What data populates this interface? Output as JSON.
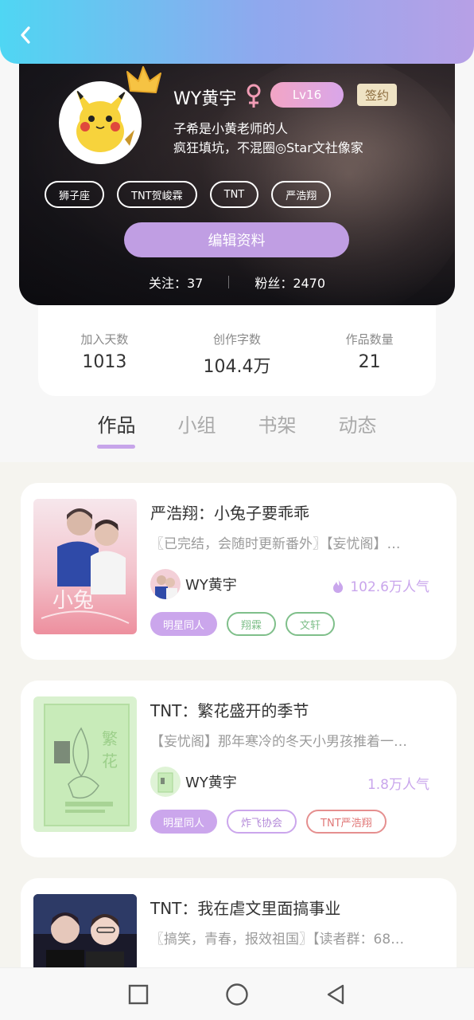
{
  "profile": {
    "username": "WY黄宇",
    "level": "Lv16",
    "sign_label": "签约",
    "bio_line1": "子希是小黄老师的人",
    "bio_line2": "疯狂填坑，不混圈◎Star文社像家",
    "tags": [
      "狮子座",
      "TNT贺峻霖",
      "TNT",
      "严浩翔"
    ],
    "edit_label": "编辑资料",
    "following_label": "关注：37",
    "followers_label": "粉丝：2470"
  },
  "stats": [
    {
      "label": "加入天数",
      "value": "1013"
    },
    {
      "label": "创作字数",
      "value": "104.4万"
    },
    {
      "label": "作品数量",
      "value": "21"
    }
  ],
  "tabs": [
    "作品",
    "小组",
    "书架",
    "动态"
  ],
  "works": [
    {
      "title": "严浩翔：小兔子要乖乖",
      "desc": "〖已完结，会随时更新番外〗【妄忧阁】…",
      "author": "WY黄宇",
      "popularity": "102.6万人气",
      "tags": [
        {
          "label": "明星同人",
          "style": "filled"
        },
        {
          "label": "翔霖",
          "style": "green"
        },
        {
          "label": "文轩",
          "style": "green"
        }
      ]
    },
    {
      "title": "TNT：繁花盛开的季节",
      "desc": "【妄忧阁】那年寒冷的冬天小男孩推着一…",
      "author": "WY黄宇",
      "popularity": "1.8万人气",
      "tags": [
        {
          "label": "明星同人",
          "style": "filled"
        },
        {
          "label": "炸飞协会",
          "style": "purple"
        },
        {
          "label": "TNT严浩翔",
          "style": "red"
        }
      ]
    },
    {
      "title": "TNT：我在虐文里面搞事业",
      "desc": "〖搞笑，青春，报效祖国〗【读者群：68…"
    }
  ],
  "colors": {
    "accent": "#c09ee3",
    "header_start": "#4fd6f3",
    "header_end": "#b7a0e6"
  },
  "nav": [
    "square-icon",
    "circle-icon",
    "back-triangle-icon"
  ]
}
